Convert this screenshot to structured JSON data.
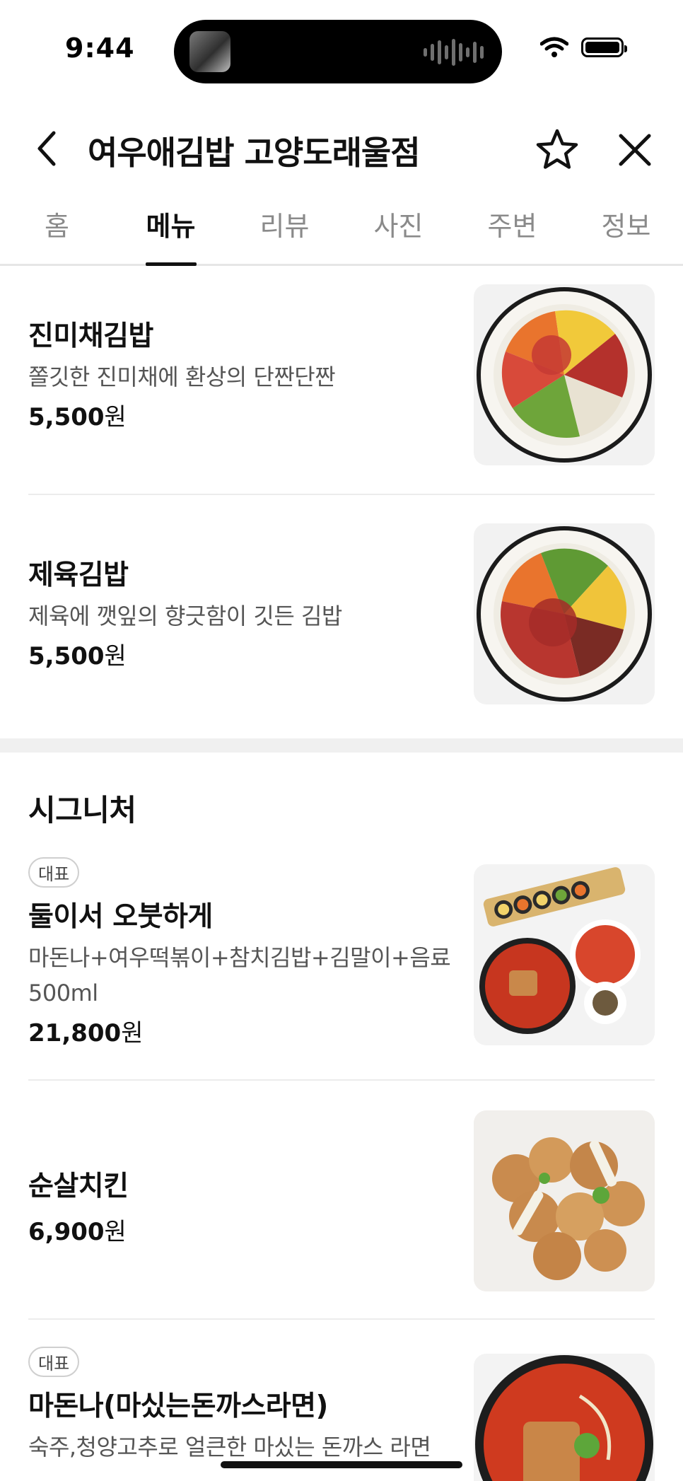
{
  "status_bar": {
    "time": "9:44"
  },
  "header": {
    "title": "여우애김밥 고양도래울점"
  },
  "tabs": [
    {
      "label": "홈",
      "active": false
    },
    {
      "label": "메뉴",
      "active": true
    },
    {
      "label": "리뷰",
      "active": false
    },
    {
      "label": "사진",
      "active": false
    },
    {
      "label": "주변",
      "active": false
    },
    {
      "label": "정보",
      "active": false
    }
  ],
  "menu_top": [
    {
      "name": "진미채김밥",
      "desc": "쫄깃한 진미채에 환상의 단짠단짠",
      "price": "5,500",
      "unit": "원"
    },
    {
      "name": "제육김밥",
      "desc": "제육에 깻잎의 향긋함이 깃든 김밥",
      "price": "5,500",
      "unit": "원"
    }
  ],
  "signature": {
    "title": "시그니처",
    "items": [
      {
        "badge": "대표",
        "name": "둘이서 오붓하게",
        "desc": "마돈나+여우떡볶이+참치김밥+김말이+음료 500ml",
        "price": "21,800",
        "unit": "원"
      },
      {
        "badge": "",
        "name": "순살치킨",
        "desc": "",
        "price": "6,900",
        "unit": "원"
      },
      {
        "badge": "대표",
        "name": "마돈나(마싰는돈까스라면)",
        "desc": "숙주,청양고추로 얼큰한 마싰는 돈까스 라면",
        "price": "",
        "unit": ""
      }
    ]
  },
  "icons": {
    "back": "chevron-left-icon",
    "favorite": "star-outline-icon",
    "close": "close-icon",
    "wifi": "wifi-icon",
    "battery": "battery-icon"
  }
}
